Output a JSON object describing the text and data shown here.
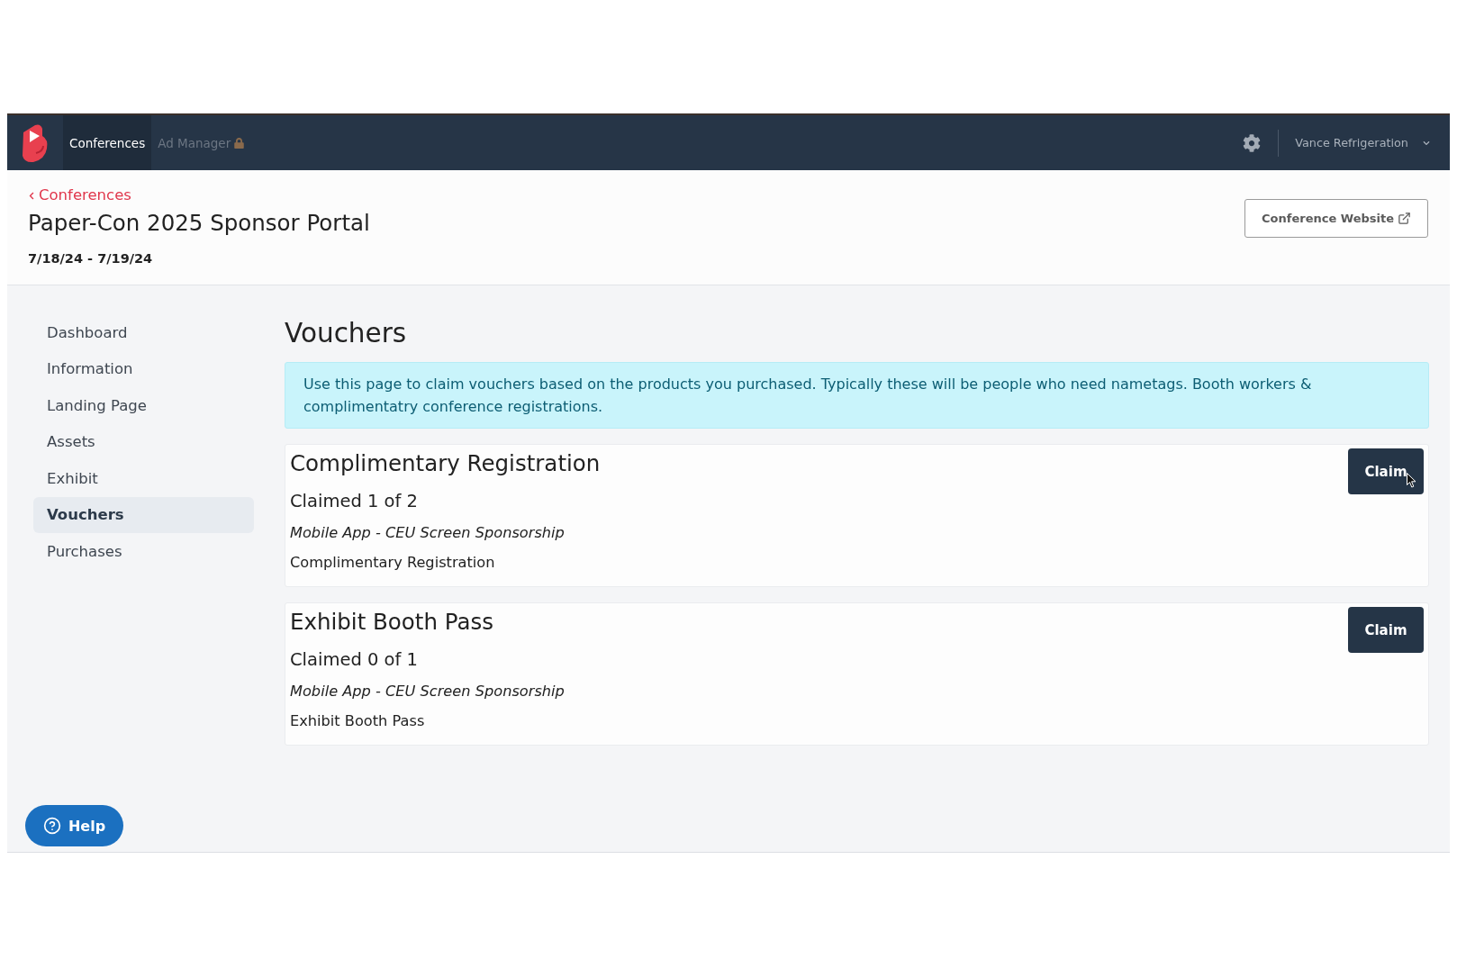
{
  "nav": {
    "tabs": [
      {
        "label": "Conferences",
        "selected": true,
        "locked": false
      },
      {
        "label": "Ad Manager",
        "selected": false,
        "locked": true
      }
    ],
    "account": "Vance Refrigeration"
  },
  "header": {
    "back_link": "Conferences",
    "title": "Paper-Con 2025 Sponsor Portal",
    "dates": "7/18/24 - 7/19/24",
    "website_button": "Conference Website"
  },
  "sidebar": {
    "items": [
      {
        "label": "Dashboard",
        "selected": false
      },
      {
        "label": "Information",
        "selected": false
      },
      {
        "label": "Landing Page",
        "selected": false
      },
      {
        "label": "Assets",
        "selected": false
      },
      {
        "label": "Exhibit",
        "selected": false
      },
      {
        "label": "Vouchers",
        "selected": true
      },
      {
        "label": "Purchases",
        "selected": false
      }
    ]
  },
  "main": {
    "heading": "Vouchers",
    "notice": "Use this page to claim vouchers based on the products you purchased. Typically these will be people who need nametags. Booth workers & complimentatry conference registrations.",
    "vouchers": [
      {
        "title": "Complimentary Registration",
        "claimed": "Claimed 1 of 2",
        "product": "Mobile App - CEU Screen Sponsorship",
        "item": "Complimentary Registration",
        "button": "Claim",
        "pointer_over_button": true
      },
      {
        "title": "Exhibit Booth Pass",
        "claimed": "Claimed 0 of 1",
        "product": "Mobile App - CEU Screen Sponsorship",
        "item": "Exhibit Booth Pass",
        "button": "Claim",
        "pointer_over_button": false
      }
    ]
  },
  "help_button": "Help"
}
